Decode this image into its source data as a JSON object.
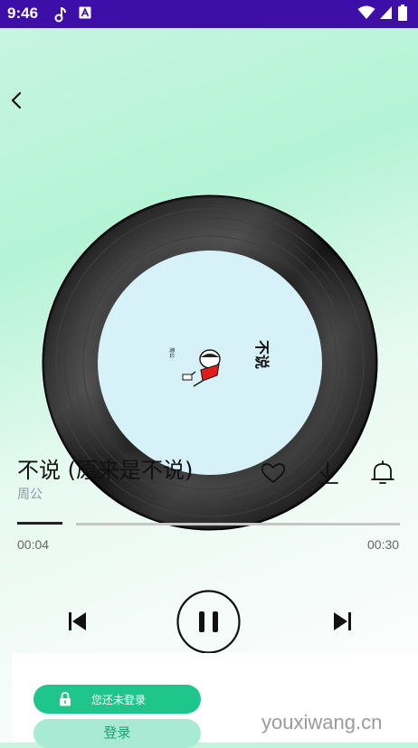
{
  "status_bar": {
    "time": "9:46",
    "left_icons": [
      "music-note-icon",
      "a-badge-icon"
    ],
    "right_icons": [
      "wifi-icon",
      "signal-icon",
      "battery-icon"
    ],
    "color": "#3d0fa8"
  },
  "header": {
    "back_icon": "chevron-left-icon"
  },
  "disc": {
    "cover_title": "不说",
    "cover_artist": "周公",
    "cover_bg": "#d6f2f8"
  },
  "song": {
    "title": "不说 (原来是不说)",
    "artist": "周公"
  },
  "actions": [
    "heart-icon",
    "download-icon",
    "bell-icon"
  ],
  "progress": {
    "current": "00:04",
    "total": "00:30",
    "fraction": 0.13
  },
  "controls": [
    "previous-icon",
    "pause-icon",
    "next-icon"
  ],
  "login": {
    "notice": "您还未登录",
    "button": "登录",
    "accent": "#1ec68c"
  },
  "watermark": "youxiwang.cn"
}
